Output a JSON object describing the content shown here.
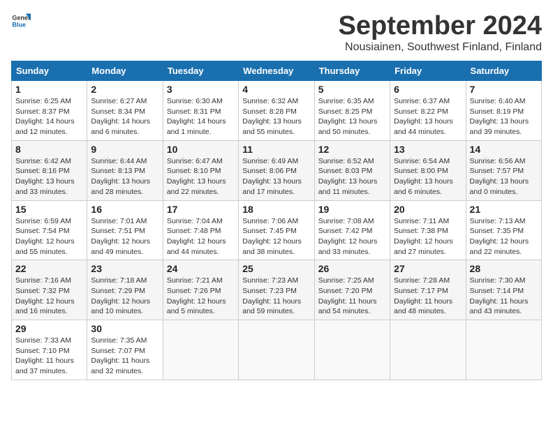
{
  "header": {
    "logo_general": "General",
    "logo_blue": "Blue",
    "month_title": "September 2024",
    "location": "Nousiainen, Southwest Finland, Finland"
  },
  "days_of_week": [
    "Sunday",
    "Monday",
    "Tuesday",
    "Wednesday",
    "Thursday",
    "Friday",
    "Saturday"
  ],
  "weeks": [
    [
      {
        "day": "1",
        "info": "Sunrise: 6:25 AM\nSunset: 8:37 PM\nDaylight: 14 hours\nand 12 minutes."
      },
      {
        "day": "2",
        "info": "Sunrise: 6:27 AM\nSunset: 8:34 PM\nDaylight: 14 hours\nand 6 minutes."
      },
      {
        "day": "3",
        "info": "Sunrise: 6:30 AM\nSunset: 8:31 PM\nDaylight: 14 hours\nand 1 minute."
      },
      {
        "day": "4",
        "info": "Sunrise: 6:32 AM\nSunset: 8:28 PM\nDaylight: 13 hours\nand 55 minutes."
      },
      {
        "day": "5",
        "info": "Sunrise: 6:35 AM\nSunset: 8:25 PM\nDaylight: 13 hours\nand 50 minutes."
      },
      {
        "day": "6",
        "info": "Sunrise: 6:37 AM\nSunset: 8:22 PM\nDaylight: 13 hours\nand 44 minutes."
      },
      {
        "day": "7",
        "info": "Sunrise: 6:40 AM\nSunset: 8:19 PM\nDaylight: 13 hours\nand 39 minutes."
      }
    ],
    [
      {
        "day": "8",
        "info": "Sunrise: 6:42 AM\nSunset: 8:16 PM\nDaylight: 13 hours\nand 33 minutes."
      },
      {
        "day": "9",
        "info": "Sunrise: 6:44 AM\nSunset: 8:13 PM\nDaylight: 13 hours\nand 28 minutes."
      },
      {
        "day": "10",
        "info": "Sunrise: 6:47 AM\nSunset: 8:10 PM\nDaylight: 13 hours\nand 22 minutes."
      },
      {
        "day": "11",
        "info": "Sunrise: 6:49 AM\nSunset: 8:06 PM\nDaylight: 13 hours\nand 17 minutes."
      },
      {
        "day": "12",
        "info": "Sunrise: 6:52 AM\nSunset: 8:03 PM\nDaylight: 13 hours\nand 11 minutes."
      },
      {
        "day": "13",
        "info": "Sunrise: 6:54 AM\nSunset: 8:00 PM\nDaylight: 13 hours\nand 6 minutes."
      },
      {
        "day": "14",
        "info": "Sunrise: 6:56 AM\nSunset: 7:57 PM\nDaylight: 13 hours\nand 0 minutes."
      }
    ],
    [
      {
        "day": "15",
        "info": "Sunrise: 6:59 AM\nSunset: 7:54 PM\nDaylight: 12 hours\nand 55 minutes."
      },
      {
        "day": "16",
        "info": "Sunrise: 7:01 AM\nSunset: 7:51 PM\nDaylight: 12 hours\nand 49 minutes."
      },
      {
        "day": "17",
        "info": "Sunrise: 7:04 AM\nSunset: 7:48 PM\nDaylight: 12 hours\nand 44 minutes."
      },
      {
        "day": "18",
        "info": "Sunrise: 7:06 AM\nSunset: 7:45 PM\nDaylight: 12 hours\nand 38 minutes."
      },
      {
        "day": "19",
        "info": "Sunrise: 7:08 AM\nSunset: 7:42 PM\nDaylight: 12 hours\nand 33 minutes."
      },
      {
        "day": "20",
        "info": "Sunrise: 7:11 AM\nSunset: 7:38 PM\nDaylight: 12 hours\nand 27 minutes."
      },
      {
        "day": "21",
        "info": "Sunrise: 7:13 AM\nSunset: 7:35 PM\nDaylight: 12 hours\nand 22 minutes."
      }
    ],
    [
      {
        "day": "22",
        "info": "Sunrise: 7:16 AM\nSunset: 7:32 PM\nDaylight: 12 hours\nand 16 minutes."
      },
      {
        "day": "23",
        "info": "Sunrise: 7:18 AM\nSunset: 7:29 PM\nDaylight: 12 hours\nand 10 minutes."
      },
      {
        "day": "24",
        "info": "Sunrise: 7:21 AM\nSunset: 7:26 PM\nDaylight: 12 hours\nand 5 minutes."
      },
      {
        "day": "25",
        "info": "Sunrise: 7:23 AM\nSunset: 7:23 PM\nDaylight: 11 hours\nand 59 minutes."
      },
      {
        "day": "26",
        "info": "Sunrise: 7:25 AM\nSunset: 7:20 PM\nDaylight: 11 hours\nand 54 minutes."
      },
      {
        "day": "27",
        "info": "Sunrise: 7:28 AM\nSunset: 7:17 PM\nDaylight: 11 hours\nand 48 minutes."
      },
      {
        "day": "28",
        "info": "Sunrise: 7:30 AM\nSunset: 7:14 PM\nDaylight: 11 hours\nand 43 minutes."
      }
    ],
    [
      {
        "day": "29",
        "info": "Sunrise: 7:33 AM\nSunset: 7:10 PM\nDaylight: 11 hours\nand 37 minutes."
      },
      {
        "day": "30",
        "info": "Sunrise: 7:35 AM\nSunset: 7:07 PM\nDaylight: 11 hours\nand 32 minutes."
      },
      {
        "day": "",
        "info": ""
      },
      {
        "day": "",
        "info": ""
      },
      {
        "day": "",
        "info": ""
      },
      {
        "day": "",
        "info": ""
      },
      {
        "day": "",
        "info": ""
      }
    ]
  ]
}
